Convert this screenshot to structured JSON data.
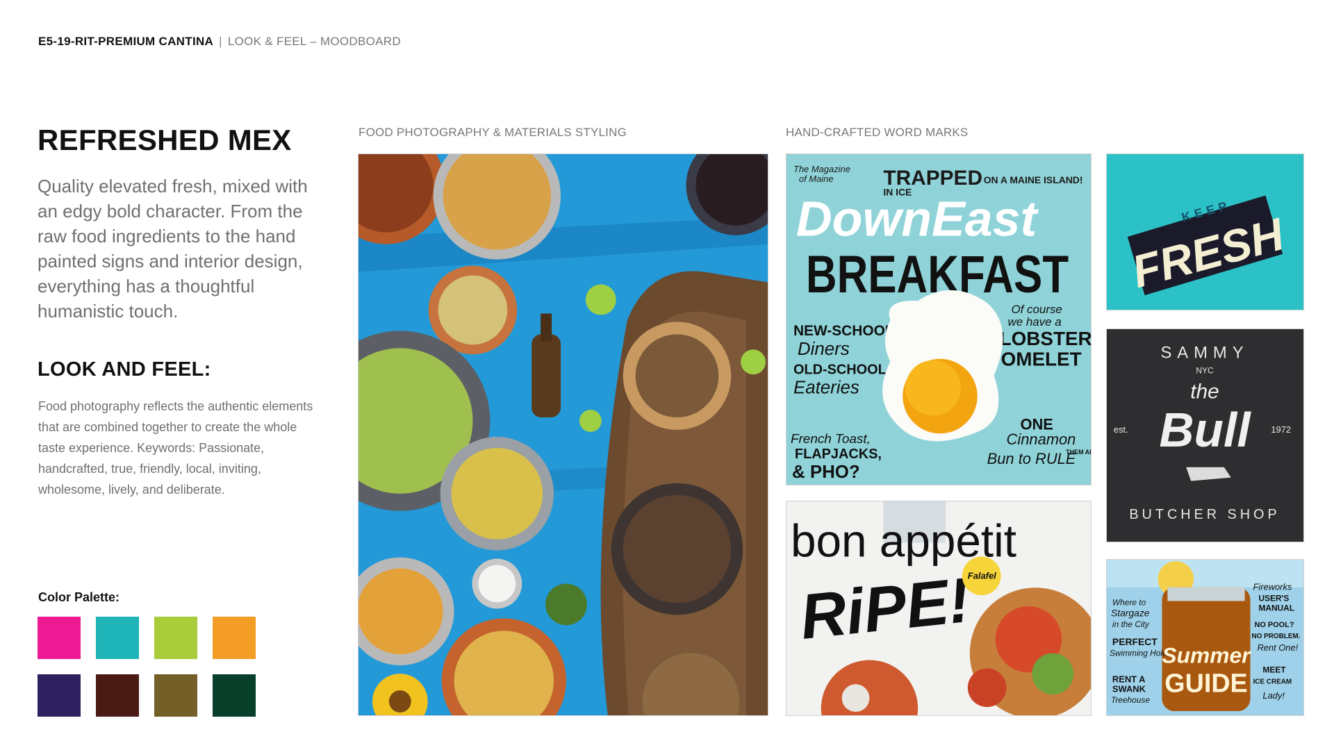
{
  "header": {
    "project": "E5-19-RIT-PREMIUM CANTINA",
    "separator": "|",
    "section": "LOOK & FEEL  –  MOODBOARD"
  },
  "left": {
    "title": "REFRESHED MEX",
    "intro": "Quality elevated fresh, mixed with an edgy bold character. From the raw food ingredients to the hand painted signs and interior design, everything has a thoughtful humanistic touch.",
    "look_feel_title": "LOOK AND FEEL:",
    "look_feel_body": "Food photography reflects the authentic elements that are combined together to create the whole taste experience. Keywords: Passionate, handcrafted, true, friendly, local, inviting, wholesome, lively, and deliberate.",
    "palette_label": "Color Palette:",
    "palette": [
      "#ec1b93",
      "#1fb4b8",
      "#a8cc3a",
      "#f39c26",
      "#2e1f5e",
      "#4a1b14",
      "#735f27",
      "#073f2a"
    ]
  },
  "captions": {
    "photo": "FOOD PHOTOGRAPHY & MATERIALS STYLING",
    "wordmarks": "HAND-CRAFTED WORD MARKS"
  },
  "downeast": {
    "tag1": "The Magazine",
    "tag2": "of Maine",
    "trapped": "TRAPPED",
    "in_ice": "IN ICE",
    "on_a_maine": "ON A MAINE ISLAND!",
    "masthead": "DownEast",
    "breakfast": "BREAKFAST",
    "new_school": "NEW-SCHOOL",
    "diners": "Diners",
    "old_school": "OLD-SCHOOL",
    "eateries": "Eateries",
    "of_course": "Of course",
    "we_have_a": "we have a",
    "lobster": "LOBSTER",
    "omelet": "OMELET",
    "french_toast": "French Toast,",
    "flapjacks": "FLAPJACKS,",
    "pho": "& PHO?",
    "one": "ONE",
    "cinnamon": "Cinnamon",
    "bun": "Bun to RULE",
    "them_all": "THEM ALL!"
  },
  "fresh": {
    "keep": "KEEP",
    "fresh": "FRESH"
  },
  "bull": {
    "sammy": "SAMMY",
    "nyc": "NYC",
    "the": "the",
    "bull": "Bull",
    "est": "est.",
    "year": "1972",
    "butcher": "BUTCHER SHOP"
  },
  "bonappetit": {
    "masthead": "bon appétit",
    "ripe": "RiPE!",
    "falafel": "Falafel"
  },
  "summer": {
    "where": "Where to",
    "stargaze": "Stargaze",
    "in_city": "in the City",
    "perfect": "PERFECT",
    "swimming": "Swimming Hole",
    "rent": "RENT A",
    "swank": "SWANK",
    "treehouse": "Treehouse",
    "fireworks": "Fireworks",
    "users": "USER'S",
    "manual": "MANUAL",
    "no_pool": "NO POOL?",
    "no_problem": "NO PROBLEM.",
    "rent_one": "Rent One!",
    "meet": "MEET",
    "ice_cream": "ICE CREAM",
    "lady": "Lady!",
    "summer": "Summer",
    "guide": "GUIDE"
  }
}
